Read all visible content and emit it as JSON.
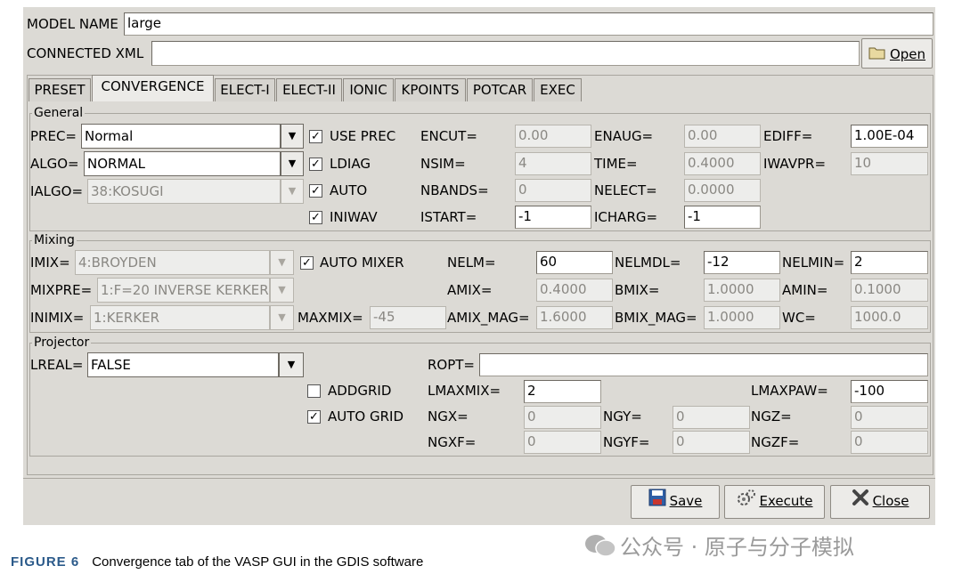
{
  "model_name": {
    "label": "MODEL NAME",
    "value": "large"
  },
  "connected_xml": {
    "label": "CONNECTED XML",
    "value": "",
    "open_label": "Open"
  },
  "tabs": [
    "PRESET",
    "CONVERGENCE",
    "ELECT-I",
    "ELECT-II",
    "IONIC",
    "KPOINTS",
    "POTCAR",
    "EXEC"
  ],
  "active_tab": "CONVERGENCE",
  "general": {
    "title": "General",
    "prec": {
      "label": "PREC=",
      "value": "Normal"
    },
    "algo": {
      "label": "ALGO=",
      "value": "NORMAL"
    },
    "ialgo": {
      "label": "IALGO=",
      "value": "38:KOSUGI"
    },
    "use_prec": {
      "label": "USE PREC",
      "checked": true
    },
    "ldiag": {
      "label": "LDIAG",
      "checked": true
    },
    "auto": {
      "label": "AUTO",
      "checked": true
    },
    "iniwav": {
      "label": "INIWAV",
      "checked": true
    },
    "encut": {
      "label": "ENCUT=",
      "value": "0.00"
    },
    "nsim": {
      "label": "NSIM=",
      "value": "4"
    },
    "nbands": {
      "label": "NBANDS=",
      "value": "0"
    },
    "istart": {
      "label": "ISTART=",
      "value": "-1"
    },
    "enaug": {
      "label": "ENAUG=",
      "value": "0.00"
    },
    "time": {
      "label": "TIME=",
      "value": "0.4000"
    },
    "nelect": {
      "label": "NELECT=",
      "value": "0.0000"
    },
    "icharg": {
      "label": "ICHARG=",
      "value": "-1"
    },
    "ediff": {
      "label": "EDIFF=",
      "value": "1.00E-04"
    },
    "iwavpr": {
      "label": "IWAVPR=",
      "value": "10"
    }
  },
  "mixing": {
    "title": "Mixing",
    "imix": {
      "label": "IMIX=",
      "value": "4:BROYDEN"
    },
    "mixpre": {
      "label": "MIXPRE=",
      "value": "1:F=20 INVERSE KERKER"
    },
    "inimix": {
      "label": "INIMIX=",
      "value": "1:KERKER"
    },
    "auto_mixer": {
      "label": "AUTO MIXER",
      "checked": true
    },
    "maxmix": {
      "label": "MAXMIX=",
      "value": "-45"
    },
    "nelm": {
      "label": "NELM=",
      "value": "60"
    },
    "amix": {
      "label": "AMIX=",
      "value": "0.4000"
    },
    "amix_mag": {
      "label": "AMIX_MAG=",
      "value": "1.6000"
    },
    "nelmdl": {
      "label": "NELMDL=",
      "value": "-12"
    },
    "bmix": {
      "label": "BMIX=",
      "value": "1.0000"
    },
    "bmix_mag": {
      "label": "BMIX_MAG=",
      "value": "1.0000"
    },
    "nelmin": {
      "label": "NELMIN=",
      "value": "2"
    },
    "amin": {
      "label": "AMIN=",
      "value": "0.1000"
    },
    "wc": {
      "label": "WC=",
      "value": "1000.0"
    }
  },
  "projector": {
    "title": "Projector",
    "lreal": {
      "label": "LREAL=",
      "value": "FALSE"
    },
    "ropt": {
      "label": "ROPT=",
      "value": ""
    },
    "addgrid": {
      "label": "ADDGRID",
      "checked": false
    },
    "auto_grid": {
      "label": "AUTO GRID",
      "checked": true
    },
    "lmaxmix": {
      "label": "LMAXMIX=",
      "value": "2"
    },
    "lmaxpaw": {
      "label": "LMAXPAW=",
      "value": "-100"
    },
    "ngx": {
      "label": "NGX=",
      "value": "0"
    },
    "ngy": {
      "label": "NGY=",
      "value": "0"
    },
    "ngz": {
      "label": "NGZ=",
      "value": "0"
    },
    "ngxf": {
      "label": "NGXF=",
      "value": "0"
    },
    "ngyf": {
      "label": "NGYF=",
      "value": "0"
    },
    "ngzf": {
      "label": "NGZF=",
      "value": "0"
    }
  },
  "buttons": {
    "save": "Save",
    "execute": "Execute",
    "close": "Close"
  },
  "caption": {
    "figure": "FIGURE 6",
    "text": "Convergence tab of the VASP GUI in the GDIS software"
  },
  "watermark": "公众号 · 原子与分子模拟",
  "colors": {
    "window_bg": "#dcdad5",
    "field_bg": "#ffffff",
    "disabled_field_bg": "#ededeb",
    "caption_blue": "#2b5a8a"
  }
}
